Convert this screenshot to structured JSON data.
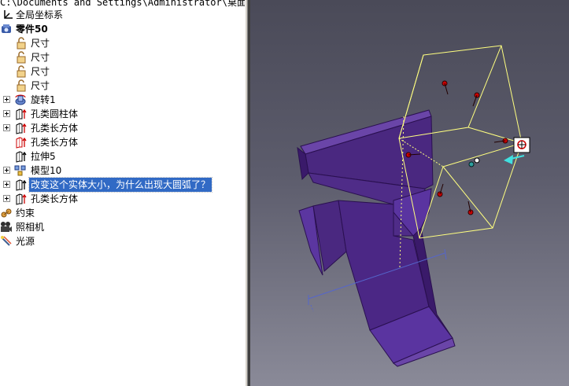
{
  "tree": {
    "path_text": "C:\\Documents and Settings\\Administrator\\桌面\\",
    "items": [
      {
        "label": "全局坐标系",
        "icon": "axis-icon"
      },
      {
        "label": "零件50",
        "icon": "part-icon"
      },
      {
        "label": "尺寸",
        "icon": "lock-icon"
      },
      {
        "label": "尺寸",
        "icon": "lock-icon"
      },
      {
        "label": "尺寸",
        "icon": "lock-icon"
      },
      {
        "label": "尺寸",
        "icon": "lock-icon"
      },
      {
        "label": "旋转1",
        "icon": "revolve-icon"
      },
      {
        "label": "孔类圆柱体",
        "icon": "hole-cylinder-icon"
      },
      {
        "label": "孔类长方体",
        "icon": "hole-box-icon"
      },
      {
        "label": "孔类长方体",
        "icon": "hole-box-icon"
      },
      {
        "label": "拉伸5",
        "icon": "extrude-icon"
      },
      {
        "label": "模型10",
        "icon": "model-icon"
      },
      {
        "label": "改变这个实体大小，为什么出现大圆弧了？",
        "icon": "extrude-icon"
      },
      {
        "label": "孔类长方体",
        "icon": "hole-box-icon"
      },
      {
        "label": "约束",
        "icon": "constraint-icon"
      },
      {
        "label": "照相机",
        "icon": "camera-icon"
      },
      {
        "label": "光源",
        "icon": "light-icon"
      }
    ]
  },
  "colors": {
    "selection": "#316ac5",
    "part_body": "#4b2785",
    "bounding_box": "#ffff80",
    "handle": "#cc0000",
    "dimension_line": "#5566cc"
  }
}
